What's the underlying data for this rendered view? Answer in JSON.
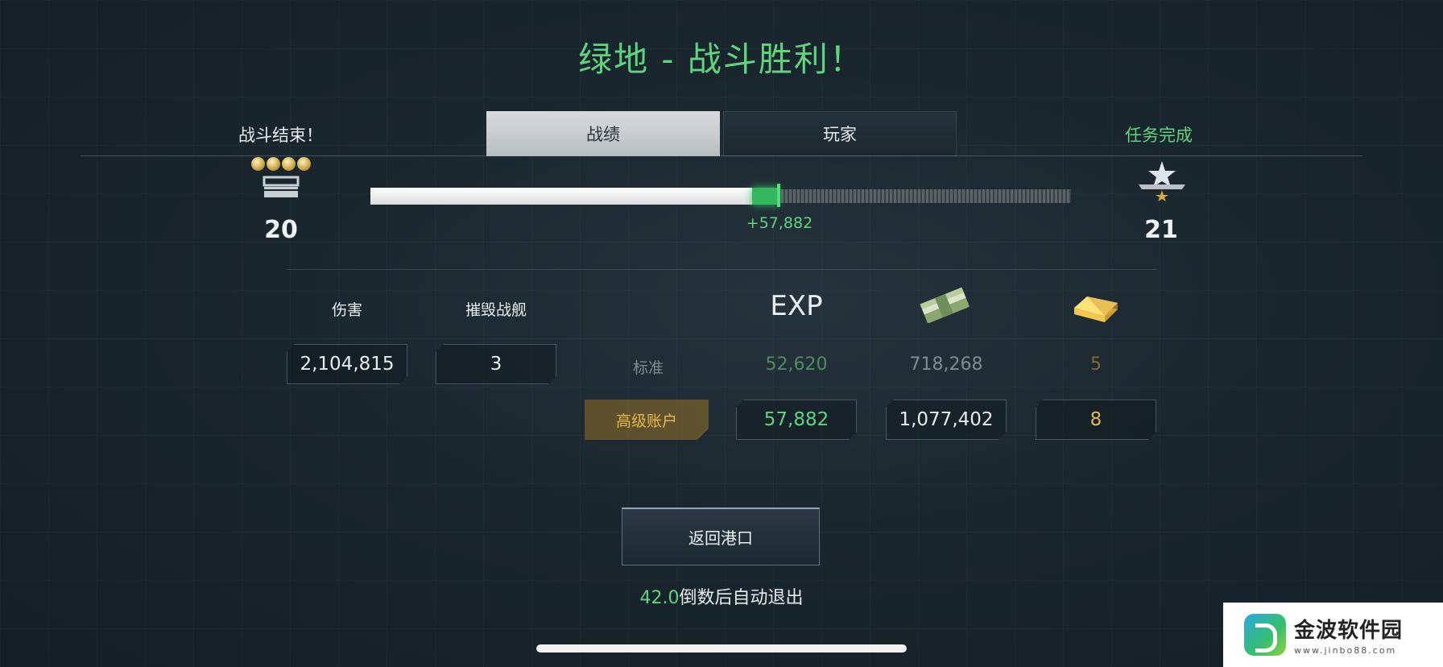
{
  "header": {
    "title": "绿地 - 战斗胜利！"
  },
  "left_label": "战斗结束！",
  "right_label": "任务完成",
  "tabs": [
    {
      "label": "战绩",
      "active": true
    },
    {
      "label": "玩家",
      "active": false
    }
  ],
  "rank": {
    "current": "20",
    "next": "21"
  },
  "progress": {
    "base_fraction": 0.545,
    "gain_fraction": 0.038,
    "gain_text": "+57,882"
  },
  "stats": {
    "damage_label": "伤害",
    "damage_value": "2,104,815",
    "destroyed_label": "摧毁战舰",
    "destroyed_value": "3"
  },
  "rewards": {
    "exp_header": "EXP",
    "standard_label": "标准",
    "standard": {
      "exp": "52,620",
      "money": "718,268",
      "gold": "5"
    },
    "premium_label": "高级账户",
    "premium": {
      "exp": "57,882",
      "money": "1,077,402",
      "gold": "8"
    }
  },
  "return_button": "返回港口",
  "countdown": {
    "seconds": "42.0",
    "suffix": "倒数后自动退出"
  },
  "watermark": {
    "name": "金波软件园",
    "url": "www.jinbo88.com"
  },
  "colors": {
    "accent_green": "#5fd47e",
    "premium_gold": "#e3b94a"
  }
}
